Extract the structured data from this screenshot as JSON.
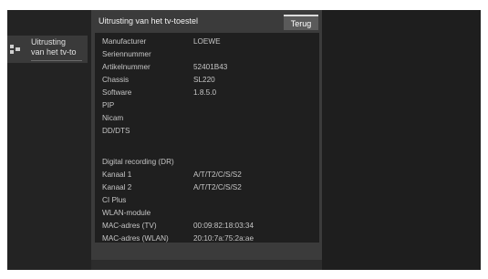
{
  "sidebar": {
    "item_label_line1": "Uitrusting",
    "item_label_line2": "van het tv-to",
    "icon": "menu-list-icon"
  },
  "dialog": {
    "title": "Uitrusting van het tv-toestel",
    "back_label": "Terug"
  },
  "rows": [
    {
      "label": "Manufacturer",
      "value": "LOEWE"
    },
    {
      "label": "Seriennummer",
      "value": ""
    },
    {
      "label": "Artikelnummer",
      "value": "52401B43"
    },
    {
      "label": "Chassis",
      "value": "SL220"
    },
    {
      "label": "Software",
      "value": "1.8.5.0"
    },
    {
      "label": "PIP",
      "value": ""
    },
    {
      "label": "Nicam",
      "value": ""
    },
    {
      "label": "DD/DTS",
      "value": ""
    },
    {
      "label": "",
      "value": ""
    },
    {
      "label": "Digital recording (DR)",
      "value": ""
    },
    {
      "label": "Kanaal 1",
      "value": "A/T/T2/C/S/S2"
    },
    {
      "label": "Kanaal 2",
      "value": "A/T/T2/C/S/S2"
    },
    {
      "label": "CI Plus",
      "value": ""
    },
    {
      "label": "WLAN-module",
      "value": ""
    },
    {
      "label": "MAC-adres (TV)",
      "value": "00:09:82:18:03:34"
    },
    {
      "label": "MAC-adres (WLAN)",
      "value": "20:10:7a:75:2a:ae"
    }
  ]
}
